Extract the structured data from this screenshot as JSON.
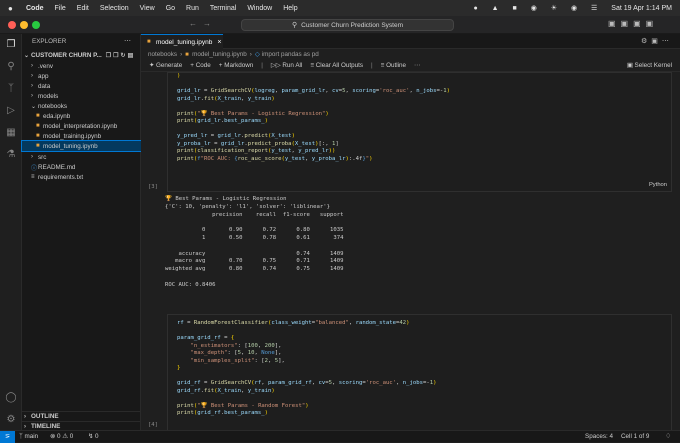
{
  "menubar": {
    "app": "Code",
    "items": [
      "File",
      "Edit",
      "Selection",
      "View",
      "Go",
      "Run",
      "Terminal",
      "Window",
      "Help"
    ],
    "clock": "Sat 19 Apr  1:14 PM"
  },
  "titlebar": {
    "command_center": "Customer Churn Prediction System"
  },
  "sidebar": {
    "explorer_title": "EXPLORER",
    "project": "CUSTOMER CHURN P...",
    "items": [
      {
        "label": ".venv",
        "kind": "folder"
      },
      {
        "label": "app",
        "kind": "folder"
      },
      {
        "label": "data",
        "kind": "folder"
      },
      {
        "label": "models",
        "kind": "folder"
      },
      {
        "label": "notebooks",
        "kind": "folder-open"
      },
      {
        "label": "eda.ipynb",
        "kind": "notebook"
      },
      {
        "label": "model_interpretation.ipynb",
        "kind": "notebook"
      },
      {
        "label": "model_training.ipynb",
        "kind": "notebook"
      },
      {
        "label": "model_tuning.ipynb",
        "kind": "notebook"
      },
      {
        "label": "src",
        "kind": "folder"
      },
      {
        "label": "README.md",
        "kind": "info"
      },
      {
        "label": "requirements.txt",
        "kind": "text"
      }
    ],
    "outline": "OUTLINE",
    "timeline": "TIMELINE"
  },
  "editor": {
    "tab": "model_tuning.ipynb",
    "breadcrumb": [
      "notebooks",
      "model_tuning.ipynb",
      "import pandas as pd"
    ],
    "toolbar": {
      "generate": "Generate",
      "code": "Code",
      "markdown": "Markdown",
      "run_all": "Run All",
      "clear": "Clear All Outputs",
      "outline": "Outline",
      "kernel": "Select Kernel"
    },
    "cell1_exec": "[3]",
    "cell1_lang": "Python",
    "cell2_exec": "[4]",
    "output": {
      "title_line": "Best Params - Logistic Regression",
      "params": "{'C': 10, 'penalty': 'l1', 'solver': 'liblinear'}",
      "header": "              precision    recall  f1-score   support",
      "rows": [
        "           0       0.90      0.72      0.80      1035",
        "           1       0.50      0.78      0.61       374",
        "",
        "    accuracy                           0.74      1409",
        "   macro avg       0.70      0.75      0.71      1409",
        "weighted avg       0.80      0.74      0.75      1409"
      ],
      "auc": "ROC AUC: 0.8406"
    }
  },
  "statusbar": {
    "branch": "main",
    "problems": "0",
    "warnings": "0",
    "ports": "0",
    "spaces": "Spaces: 4",
    "cell": "Cell 1 of 9"
  }
}
